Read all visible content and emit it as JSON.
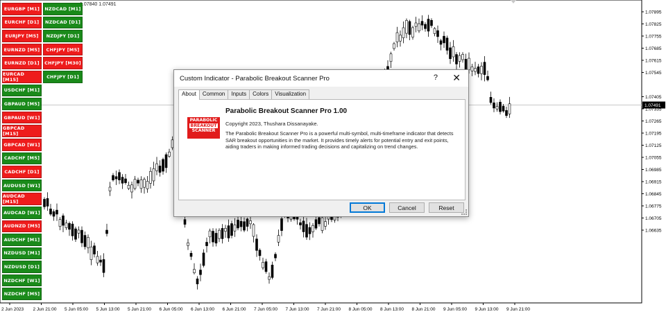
{
  "chart": {
    "top_info": "1.07840 1.07491",
    "current_price": "1.07491",
    "price_labels": [
      "1.07895",
      "1.07825",
      "1.07755",
      "1.07685",
      "1.07615",
      "1.07545",
      "1.07405",
      "1.07335",
      "1.07265",
      "1.07195",
      "1.07125",
      "1.07055",
      "1.06985",
      "1.06915",
      "1.06845",
      "1.06775",
      "1.06705",
      "1.06635"
    ],
    "time_labels": [
      "2 Jun 2023",
      "2 Jun 21:00",
      "5 Jun 05:00",
      "5 Jun 13:00",
      "5 Jun 21:00",
      "6 Jun 05:00",
      "6 Jun 13:00",
      "6 Jun 21:00",
      "7 Jun 05:00",
      "7 Jun 13:00",
      "7 Jun 21:00",
      "8 Jun 05:00",
      "8 Jun 13:00",
      "8 Jun 21:00",
      "9 Jun 05:00",
      "9 Jun 13:00",
      "9 Jun 21:00"
    ],
    "colors": {
      "bull": "#ffffff",
      "bear": "#000000",
      "grid": "#c8c8c8",
      "price_tag_bg": "#000000"
    }
  },
  "buttons_col1": [
    {
      "label": "EURGBP [M1]",
      "color": "red"
    },
    {
      "label": "EURCHF [D1]",
      "color": "red"
    },
    {
      "label": "EURJPY [M5]",
      "color": "red"
    },
    {
      "label": "EURNZD [M5]",
      "color": "red"
    },
    {
      "label": "EURNZD [D1]",
      "color": "red"
    },
    {
      "label": "EURCAD [M15]",
      "color": "red"
    },
    {
      "label": "USDCHF [M1]",
      "color": "green"
    },
    {
      "label": "GBPAUD [M5]",
      "color": "green"
    },
    {
      "label": "GBPAUD [W1]",
      "color": "red"
    },
    {
      "label": "GBPCAD [M15]",
      "color": "red"
    },
    {
      "label": "GBPCAD [W1]",
      "color": "red"
    },
    {
      "label": "CADCHF [M5]",
      "color": "green"
    },
    {
      "label": "CADCHF [D1]",
      "color": "red"
    },
    {
      "label": "AUDUSD [W1]",
      "color": "green"
    },
    {
      "label": "AUDCAD [M15]",
      "color": "red"
    },
    {
      "label": "AUDCAD [W1]",
      "color": "green"
    },
    {
      "label": "AUDNZD [M5]",
      "color": "red"
    },
    {
      "label": "AUDCHF [M1]",
      "color": "green"
    },
    {
      "label": "NZDUSD [M1]",
      "color": "green"
    },
    {
      "label": "NZDUSD [D1]",
      "color": "green"
    },
    {
      "label": "NZDCHF [W1]",
      "color": "green"
    },
    {
      "label": "NZDCHF [M5]",
      "color": "green"
    }
  ],
  "buttons_col2": [
    {
      "label": "NZDCAD [M1]",
      "color": "green"
    },
    {
      "label": "NZDCAD [D1]",
      "color": "green"
    },
    {
      "label": "NZDJPY [D1]",
      "color": "green"
    },
    {
      "label": "CHFJPY [M5]",
      "color": "red"
    },
    {
      "label": "CHFJPY [M30]",
      "color": "red"
    },
    {
      "label": "CHFJPY [D1]",
      "color": "green"
    }
  ],
  "dialog": {
    "title": "Custom Indicator - Parabolic Breakout Scanner Pro",
    "help": "?",
    "close": "✕",
    "tabs": [
      "About",
      "Common",
      "Inputs",
      "Colors",
      "Visualization"
    ],
    "logo": {
      "line1": "PARABOLIC",
      "line2": "BREAKOUT",
      "line3": "SCANNER"
    },
    "indicator_title": "Parabolic Breakout Scanner Pro 1.00",
    "copyright": "Copyright 2023, Thushara Dissanayake.",
    "description": "The Parabolic Breakout Scanner Pro is a powerful multi-symbol, multi-timeframe indicator that detects SAR breakout opportunities in the market. It provides timely alerts for potential entry and exit points, aiding traders in making informed trading decisions and capitalizing on trend changes.",
    "ok": "OK",
    "cancel": "Cancel",
    "reset": "Reset"
  }
}
